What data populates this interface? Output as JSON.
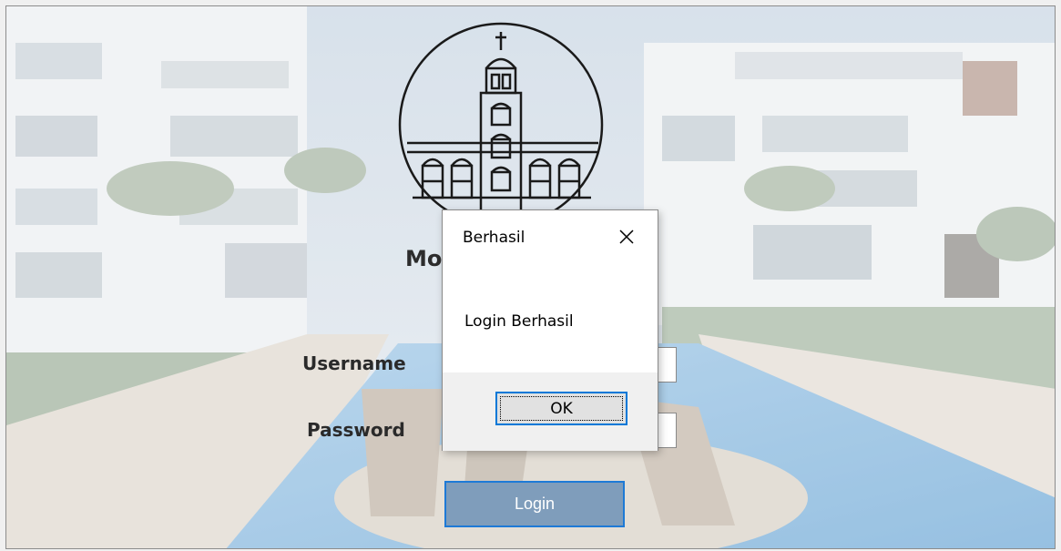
{
  "app": {
    "brand_text": "Mo",
    "form": {
      "username_label": "Username",
      "password_label": "Password",
      "login_label": "Login"
    }
  },
  "dialog": {
    "title": "Berhasil",
    "message": "Login Berhasil",
    "ok_label": "OK",
    "close_icon": "close-icon"
  },
  "colors": {
    "accent": "#0078d7",
    "login_button_bg": "#7f9dbb",
    "background_overlay": "#d8dde2"
  }
}
